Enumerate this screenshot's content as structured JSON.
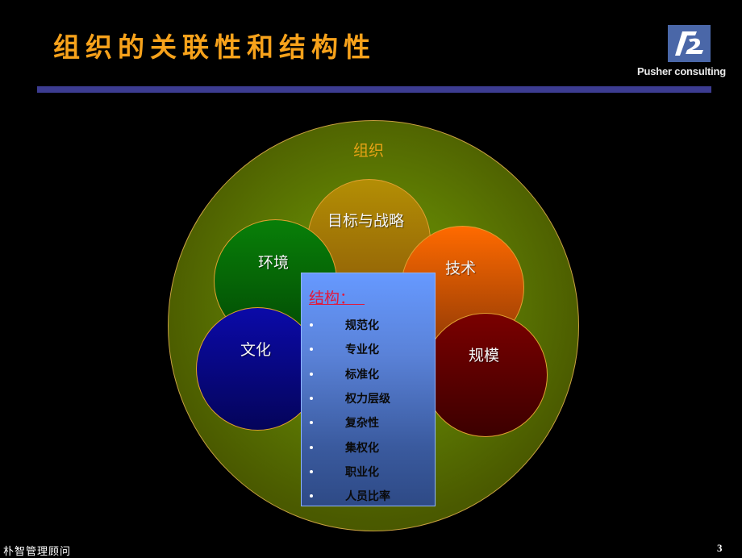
{
  "header": {
    "title": "组织的关联性和结构性",
    "logo_icon": "pusher-logo-icon",
    "logo_text": "Pusher consulting"
  },
  "diagram": {
    "outer_label": "组织",
    "circles": [
      {
        "label": "目标与战略",
        "color": "#b38e05"
      },
      {
        "label": "环境",
        "color": "#087f08"
      },
      {
        "label": "技术",
        "color": "#ff6a00"
      },
      {
        "label": "文化",
        "color": "#0b0aa8"
      },
      {
        "label": "规模",
        "color": "#7a0000"
      }
    ],
    "structure": {
      "heading": "结构：  ",
      "items": [
        "规范化",
        "专业化",
        "标准化",
        "权力层级",
        "复杂性",
        "集权化",
        "职业化",
        "人员比率"
      ]
    }
  },
  "footer": {
    "company": "朴智管理顾问",
    "page_number": "3"
  },
  "colors": {
    "title": "#f7a21b",
    "rule": "#3c3c91",
    "outer_label": "#e8a316",
    "structure_heading": "#e01a3c"
  }
}
